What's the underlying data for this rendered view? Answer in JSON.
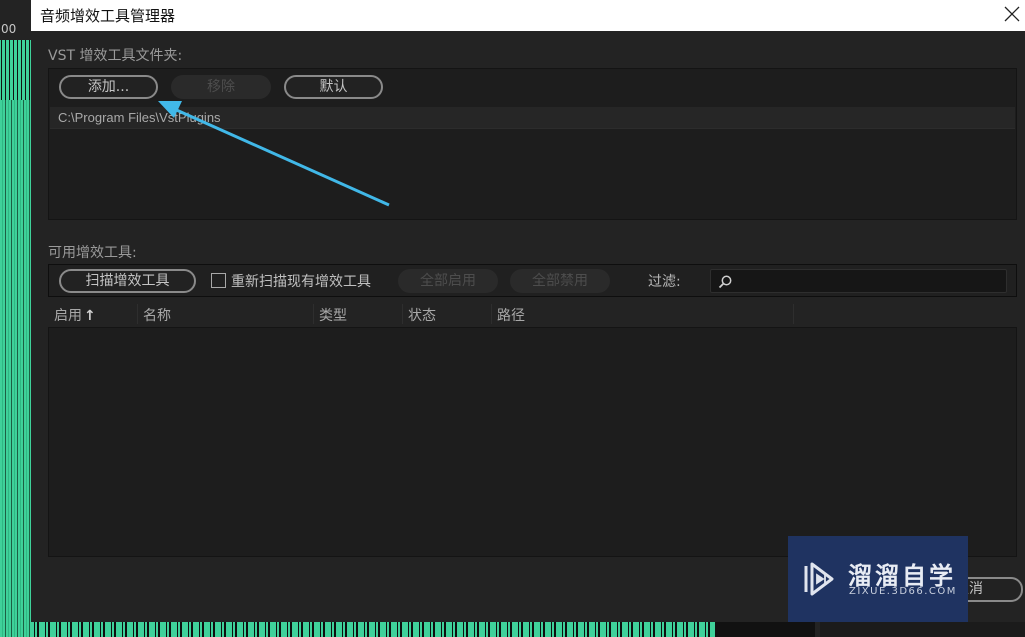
{
  "background": {
    "ruler_label": "00"
  },
  "dialog": {
    "title": "音频增效工具管理器",
    "close_icon": "close-icon",
    "vst_section": {
      "label": "VST 增效工具文件夹:",
      "buttons": {
        "add": "添加...",
        "remove": "移除",
        "default": "默认"
      },
      "folders": [
        "C:\\Program Files\\VstPlugins"
      ]
    },
    "available_section": {
      "label": "可用增效工具:",
      "scan_button": "扫描增效工具",
      "rescan_checkbox": {
        "label": "重新扫描现有增效工具",
        "checked": false
      },
      "enable_all": "全部启用",
      "disable_all": "全部禁用",
      "filter_label": "过滤:",
      "filter_value": "",
      "search_icon": "search-icon",
      "table": {
        "columns": [
          "启用",
          "名称",
          "类型",
          "状态",
          "路径"
        ],
        "sort_indicator": "↑",
        "rows": []
      }
    },
    "footer": {
      "cancel_button": "取消"
    }
  },
  "watermark": {
    "title": "溜溜自学",
    "subtitle": "ZIXUE.3D66.COM"
  },
  "annotation": {
    "arrow_color": "#41b8e8",
    "points_to": "add-button"
  }
}
